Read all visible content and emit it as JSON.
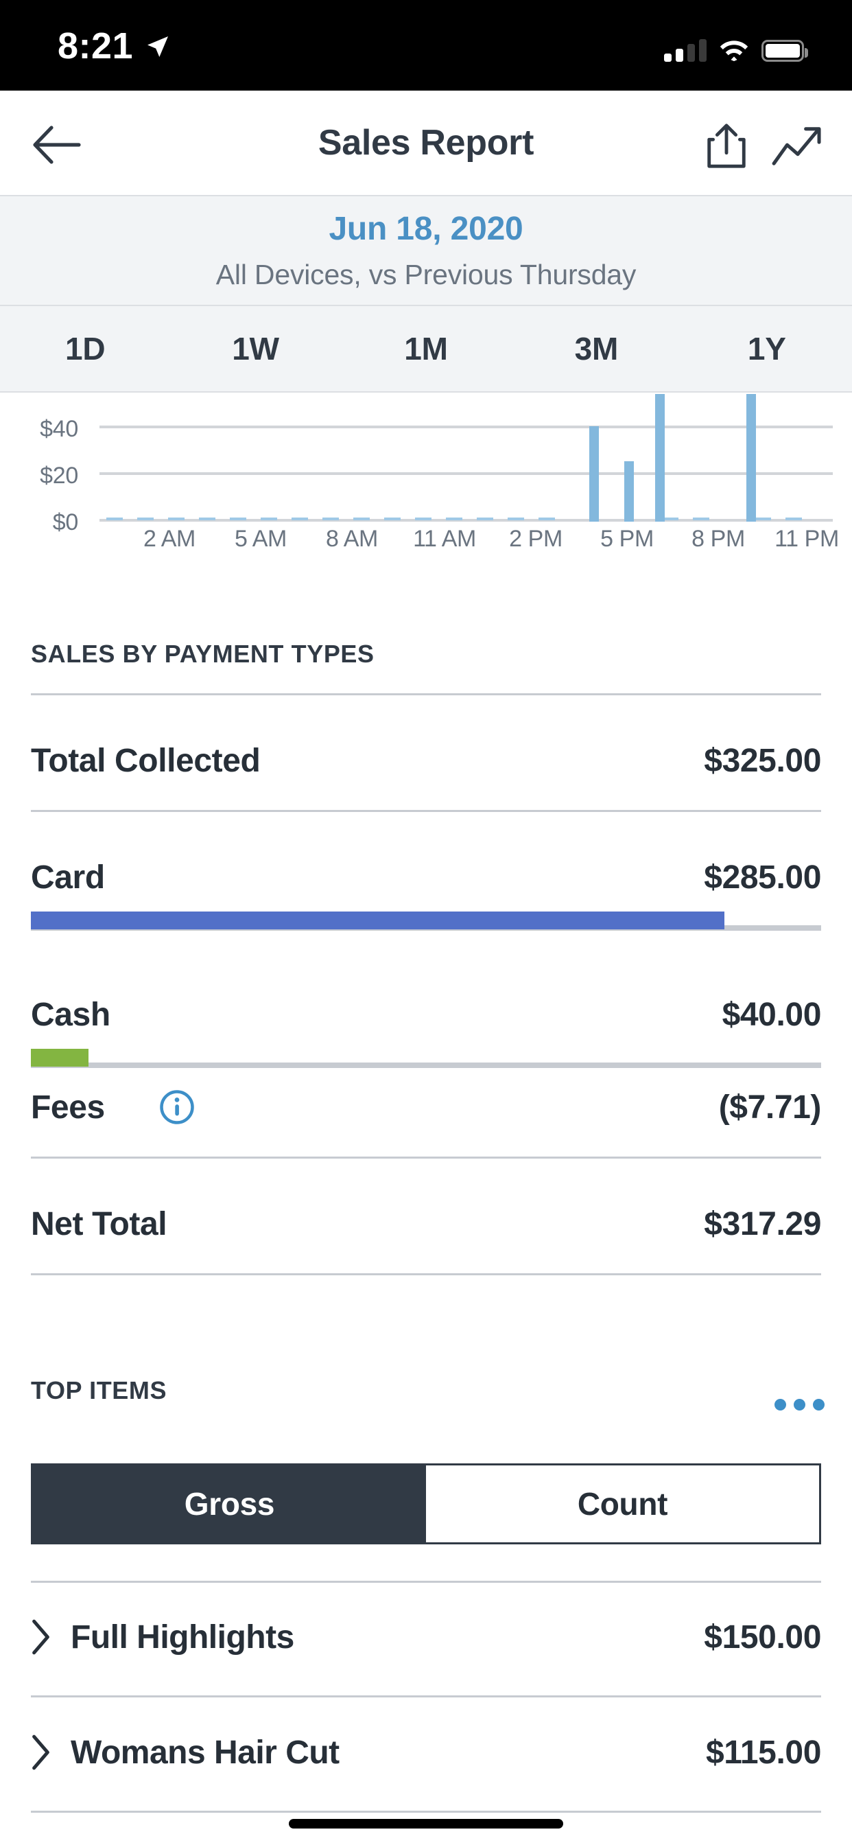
{
  "status_bar": {
    "time": "8:21",
    "location_icon": "location-arrow-icon",
    "signal_icon": "cellular-signal-icon",
    "wifi_icon": "wifi-icon",
    "battery_icon": "battery-full-icon"
  },
  "nav": {
    "back_icon": "back-arrow-icon",
    "title": "Sales Report",
    "share_icon": "share-icon",
    "trend_icon": "trending-up-icon"
  },
  "date_header": {
    "date": "Jun 18, 2020",
    "subtitle": "All Devices, vs Previous Thursday",
    "date_color": "#4a90c4"
  },
  "range_tabs": {
    "selected": "1D",
    "items": [
      {
        "label": "1D"
      },
      {
        "label": "1W"
      },
      {
        "label": "1M"
      },
      {
        "label": "3M"
      },
      {
        "label": "1Y"
      }
    ]
  },
  "chart_data": {
    "type": "bar",
    "title": "",
    "xlabel": "",
    "ylabel": "",
    "grid": true,
    "legend": "none",
    "bar_color": "#83b8dd",
    "ylim": [
      0,
      55
    ],
    "yticks": [
      0,
      20,
      40
    ],
    "ytick_labels": [
      "$0",
      "$20",
      "$40"
    ],
    "xtick_labels": [
      "2 AM",
      "5 AM",
      "8 AM",
      "11 AM",
      "2 PM",
      "5 PM",
      "8 PM",
      "11 PM"
    ],
    "categories": [
      "12 AM",
      "1 AM",
      "2 AM",
      "3 AM",
      "4 AM",
      "5 AM",
      "6 AM",
      "7 AM",
      "8 AM",
      "9 AM",
      "10 AM",
      "11 AM",
      "12 PM",
      "1 PM",
      "2 PM",
      "3 PM",
      "4 PM",
      "5 PM",
      "6 PM",
      "7 PM",
      "8 PM",
      "9 PM",
      "10 PM",
      "11 PM"
    ],
    "values": [
      0,
      0,
      0,
      0,
      0,
      0,
      0,
      0,
      0,
      0,
      0,
      0,
      0,
      0,
      0,
      0,
      40,
      25,
      55,
      0,
      0,
      55,
      0,
      0
    ],
    "note": "bars at 6 PM and 9 PM are clipped by the top of the plot area"
  },
  "payment_section": {
    "header": "SALES BY PAYMENT TYPES",
    "rows": [
      {
        "label": "Total Collected",
        "value": "$325.00",
        "bar": null
      },
      {
        "label": "Card",
        "value": "$285.00",
        "bar": {
          "percent": 87.7,
          "color": "#5270c8"
        }
      },
      {
        "label": "Cash",
        "value": "$40.00",
        "bar": {
          "percent": 7.3,
          "color": "#83b541"
        }
      },
      {
        "label": "Fees",
        "value": "($7.71)",
        "bar": null,
        "info_icon": "info-circle-icon"
      },
      {
        "label": "Net Total",
        "value": "$317.29",
        "bar": null
      }
    ]
  },
  "top_items": {
    "header": "TOP ITEMS",
    "menu_icon": "more-horizontal-icon",
    "toggle": {
      "selected": "Gross",
      "options": [
        {
          "label": "Gross"
        },
        {
          "label": "Count"
        }
      ]
    },
    "items": [
      {
        "expand_icon": "chevron-right-icon",
        "name": "Full Highlights",
        "amount": "$150.00"
      },
      {
        "expand_icon": "chevron-right-icon",
        "name": "Womans Hair Cut",
        "amount": "$115.00"
      }
    ]
  },
  "home_indicator": "home-indicator"
}
